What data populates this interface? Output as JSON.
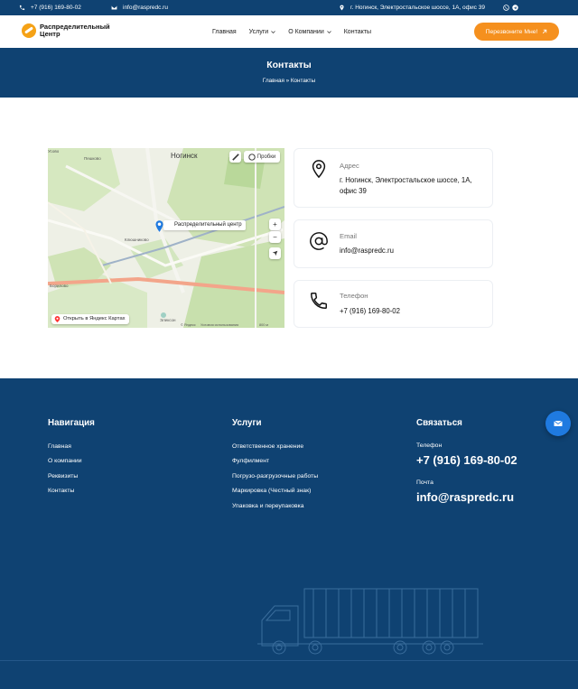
{
  "topbar": {
    "phone": "+7 (916) 169-80-02",
    "email": "info@raspredc.ru",
    "address": "г. Ногинск, Электростальское шоссе, 1А, офис 39"
  },
  "header": {
    "logo_line1": "Распределительный",
    "logo_line2": "Центр",
    "nav": {
      "home": "Главная",
      "services": "Услуги",
      "about": "О Компании",
      "contacts": "Контакты"
    },
    "cta": "Перезвоните Мне!"
  },
  "banner": {
    "title": "Контакты",
    "breadcrumb_home": "Главная",
    "breadcrumb_sep": "»",
    "breadcrumb_current": "Контакты"
  },
  "map": {
    "city": "Ногинск",
    "traffic_label": "Пробки",
    "pin_label": "Распределительный центр",
    "open_in_yandex": "Открыть в Яндекс Картах",
    "zoom_in": "+",
    "zoom_out": "−",
    "places": {
      "peshkovo": "Пешково",
      "klyushnikovo": "Клюшниково",
      "borilovo": "Борилово",
      "usovo": "Усово",
      "elekson": "Элексон"
    },
    "copyright": "© Яндекс",
    "terms": "Условия использования",
    "scale": "800 м"
  },
  "contacts": {
    "address": {
      "label": "Адрес",
      "value": "г. Ногинск, Электростальское шоссе, 1А, офис 39"
    },
    "email": {
      "label": "Email",
      "value": "info@raspredc.ru"
    },
    "phone": {
      "label": "Телефон",
      "value": "+7 (916) 169-80-02"
    }
  },
  "footer": {
    "nav": {
      "title": "Навигация",
      "links": [
        "Главная",
        "О компании",
        "Реквизиты",
        "Контакты"
      ]
    },
    "services": {
      "title": "Услуги",
      "links": [
        "Ответственное хранение",
        "Фулфилмент",
        "Погрузо-разгрузочные работы",
        "Маркировка (Честный знак)",
        "Упаковка и переупаковка"
      ]
    },
    "connect": {
      "title": "Связаться",
      "phone_label": "Телефон",
      "phone": "+7 (916) 169-80-02",
      "email_label": "Почта",
      "email": "info@raspredc.ru"
    }
  },
  "colors": {
    "brand_blue": "#0f4272",
    "accent_orange": "#f5901e",
    "float_button_blue": "#1f7ae0"
  },
  "icons": {
    "topbar": [
      "phone-icon",
      "mail-icon",
      "location-icon",
      "whatsapp-icon",
      "telegram-icon"
    ],
    "cards": [
      "location-pin-icon",
      "at-sign-icon",
      "phone-handset-icon"
    ],
    "cta": "arrow-up-right-icon",
    "float": "mail-icon"
  }
}
